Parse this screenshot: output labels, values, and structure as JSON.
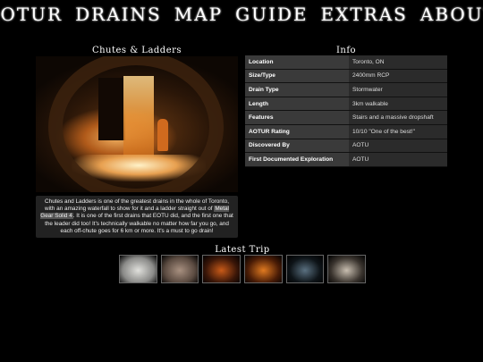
{
  "nav": [
    "AOTUR",
    "DRAINS",
    "MAP",
    "GUIDE",
    "EXTRAS",
    "ABOUT"
  ],
  "photo_section": {
    "title": "Chutes & Ladders",
    "caption_before": "Chutes and Ladders is one of the greatest drains in the whole of Toronto, with an amazing waterfall to show for it and a ladder straight out of ",
    "caption_highlight": "Metal Gear Solid 4",
    "caption_after": ". It is one of the first drains that EOTU did, and the first one that the leader did too! It's technically walkable no matter how far you go, and each off-chute goes for 6 km or more. It's a must to go drain!"
  },
  "info": {
    "title": "Info",
    "rows": [
      {
        "label": "Location",
        "value": "Toronto, ON"
      },
      {
        "label": "Size/Type",
        "value": "2400mm RCP"
      },
      {
        "label": "Drain Type",
        "value": "Stormwater"
      },
      {
        "label": "Length",
        "value": "3km walkable"
      },
      {
        "label": "Features",
        "value": "Stairs and a massive dropshaft"
      },
      {
        "label": "AOTUR Rating",
        "value": "10/10 \"One of the best!\""
      },
      {
        "label": "Discovered By",
        "value": "AOTU"
      },
      {
        "label": "First Documented Exploration",
        "value": "AOTU"
      }
    ]
  },
  "trip": {
    "title": "Latest Trip",
    "thumbs": [
      {
        "bg": "#8a8a88",
        "accent": "#e0e0dc"
      },
      {
        "bg": "#5a4a40",
        "accent": "#a89080"
      },
      {
        "bg": "#3a1608",
        "accent": "#c85a18"
      },
      {
        "bg": "#4a1c06",
        "accent": "#e07a20"
      },
      {
        "bg": "#0e1418",
        "accent": "#5a7080"
      },
      {
        "bg": "#3a342e",
        "accent": "#c8beb0"
      }
    ]
  }
}
